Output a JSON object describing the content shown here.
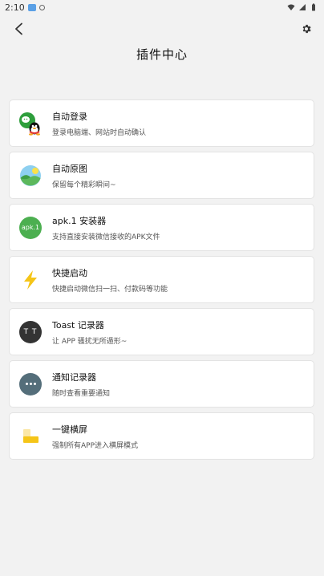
{
  "status_bar": {
    "time": "2:10",
    "icons": [
      "notification-icon",
      "sync-icon",
      "wifi-icon",
      "signal-icon",
      "battery-icon"
    ]
  },
  "header": {
    "title": "插件中心",
    "back_icon": "back-arrow-icon",
    "settings_icon": "gear-icon"
  },
  "plugins": [
    {
      "title": "自动登录",
      "desc": "登录电脑端、网站时自动确认",
      "icon": "wechat-qq-icon"
    },
    {
      "title": "自动原图",
      "desc": "保留每个精彩瞬间~",
      "icon": "landscape-image-icon"
    },
    {
      "title": "apk.1 安装器",
      "desc": "支持直接安装微信接收的APK文件",
      "icon": "apk-icon",
      "badge": "apk.1"
    },
    {
      "title": "快捷启动",
      "desc": "快捷启动微信扫一扫、付款码等功能",
      "icon": "lightning-icon"
    },
    {
      "title": "Toast 记录器",
      "desc": "让 APP 骚扰无所遁形~",
      "icon": "toast-icon",
      "badge": "T T"
    },
    {
      "title": "通知记录器",
      "desc": "随时查看重要通知",
      "icon": "chat-bubble-icon"
    },
    {
      "title": "一键横屏",
      "desc": "强制所有APP进入横屏模式",
      "icon": "landscape-rotate-icon"
    }
  ],
  "colors": {
    "background": "#f2f2f2",
    "card": "#ffffff",
    "apk_green": "#4caf50",
    "lightning_yellow": "#f5c518"
  }
}
